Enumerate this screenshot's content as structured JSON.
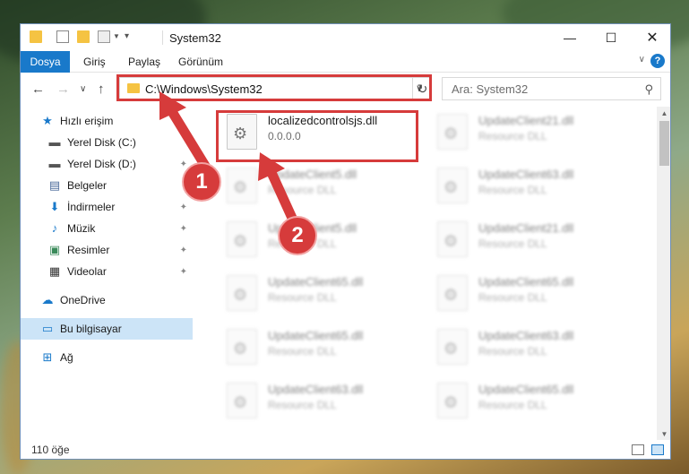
{
  "window": {
    "title": "System32"
  },
  "ribbon": {
    "tabs": [
      "Dosya",
      "Giriş",
      "Paylaş",
      "Görünüm"
    ],
    "help": "?"
  },
  "address": {
    "path": "C:\\Windows\\System32"
  },
  "search": {
    "placeholder": "Ara: System32"
  },
  "sidebar": {
    "items": [
      {
        "label": "Hızlı erişim",
        "icon": "star-icon"
      },
      {
        "label": "Yerel Disk (C:)",
        "icon": "drive-icon"
      },
      {
        "label": "Yerel Disk (D:)",
        "icon": "drive-icon"
      },
      {
        "label": "Belgeler",
        "icon": "document-icon"
      },
      {
        "label": "İndirmeler",
        "icon": "download-icon"
      },
      {
        "label": "Müzik",
        "icon": "music-icon"
      },
      {
        "label": "Resimler",
        "icon": "pictures-icon"
      },
      {
        "label": "Videolar",
        "icon": "video-icon"
      },
      {
        "label": "OneDrive",
        "icon": "cloud-icon"
      },
      {
        "label": "Bu bilgisayar",
        "icon": "computer-icon"
      },
      {
        "label": "Ağ",
        "icon": "network-icon"
      }
    ]
  },
  "files": {
    "highlighted": {
      "name": "localizedcontrolsjs.dll",
      "sub": "0.0.0.0"
    },
    "items": [
      {
        "name": "UpdateClient21.dll",
        "sub": "Resource DLL"
      },
      {
        "name": "UpdateClient5.dll",
        "sub": "Resource DLL"
      },
      {
        "name": "UpdateClient63.dll",
        "sub": "Resource DLL"
      },
      {
        "name": "UpdateClient5.dll",
        "sub": "Resource DLL"
      },
      {
        "name": "UpdateClient21.dll",
        "sub": "Resource DLL"
      },
      {
        "name": "UpdateClient65.dll",
        "sub": "Resource DLL"
      },
      {
        "name": "UpdateClient65.dll",
        "sub": "Resource DLL"
      },
      {
        "name": "UpdateClient65.dll",
        "sub": "Resource DLL"
      },
      {
        "name": "UpdateClient63.dll",
        "sub": "Resource DLL"
      },
      {
        "name": "UpdateClient63.dll",
        "sub": "Resource DLL"
      },
      {
        "name": "UpdateClient65.dll",
        "sub": "Resource DLL"
      }
    ]
  },
  "status": {
    "count": "110 öğe"
  },
  "annotations": {
    "step1": "1",
    "step2": "2"
  },
  "colors": {
    "accent": "#1979ca",
    "highlight": "#d63b3b",
    "selected": "#cce4f7"
  }
}
